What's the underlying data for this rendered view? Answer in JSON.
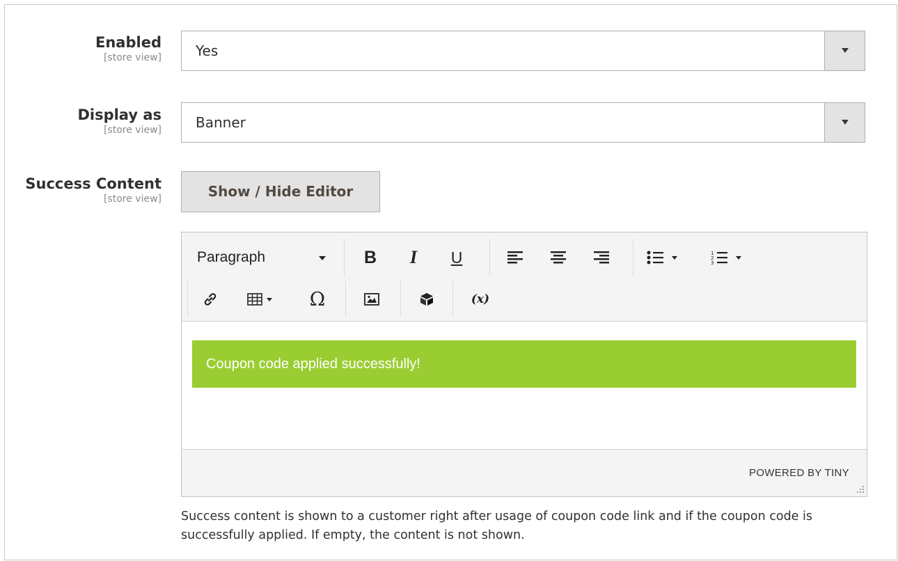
{
  "fields": {
    "enabled": {
      "label": "Enabled",
      "scope": "[store view]",
      "value": "Yes"
    },
    "display_as": {
      "label": "Display as",
      "scope": "[store view]",
      "value": "Banner"
    },
    "success_content": {
      "label": "Success Content",
      "scope": "[store view]"
    }
  },
  "editor": {
    "toggle_label": "Show / Hide Editor",
    "format_select": "Paragraph",
    "toolbar_icons": [
      "bold-icon",
      "italic-icon",
      "underline-icon",
      "align-left-icon",
      "align-center-icon",
      "align-right-icon",
      "bullet-list-icon",
      "numbered-list-icon",
      "link-icon",
      "table-icon",
      "special-character-icon",
      "image-icon",
      "widget-icon",
      "variable-icon"
    ],
    "content_banner_text": "Coupon code applied successfully!",
    "banner_color": "#9acd32",
    "powered_by": "POWERED BY TINY"
  },
  "note": "Success content is shown to a customer right after usage of coupon code link and if the coupon code is successfully applied. If empty, the content is not shown."
}
